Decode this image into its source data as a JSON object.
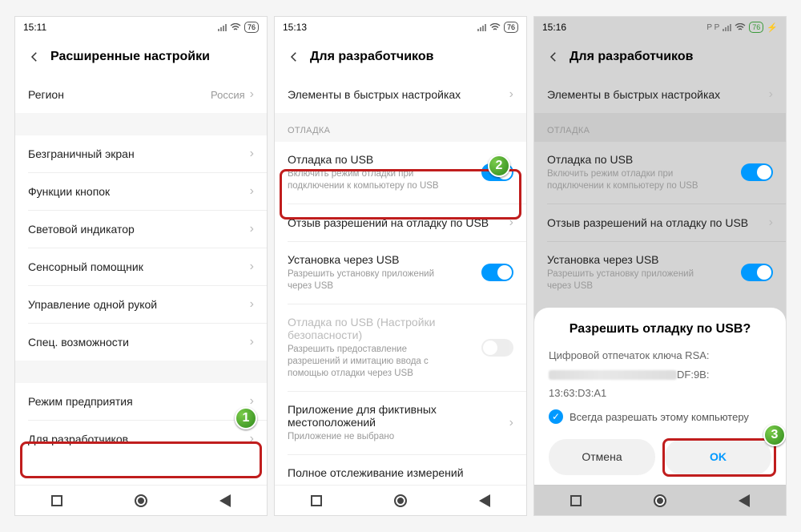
{
  "screen1": {
    "time": "15:11",
    "battery": "76",
    "title": "Расширенные настройки",
    "region_label": "Регион",
    "region_value": "Россия",
    "items": [
      "Безграничный экран",
      "Функции кнопок",
      "Световой индикатор",
      "Сенсорный помощник",
      "Управление одной рукой",
      "Спец. возможности"
    ],
    "enterprise": "Режим предприятия",
    "developers": "Для разработчиков"
  },
  "screen2": {
    "time": "15:13",
    "battery": "76",
    "title": "Для разработчиков",
    "quick_tiles": "Элементы в быстрых настройках",
    "section_debug": "ОТЛАДКА",
    "usb_debug_title": "Отладка по USB",
    "usb_debug_sub": "Включить режим отладки при подключении к компьютеру по USB",
    "revoke": "Отзыв разрешений на отладку по USB",
    "install_usb_title": "Установка через USB",
    "install_usb_sub": "Разрешить установку приложений через USB",
    "security_title": "Отладка по USB (Настройки безопасности)",
    "security_sub": "Разрешить предоставление разрешений и имитацию ввода с помощью отладки через USB",
    "mock_loc_title": "Приложение для фиктивных местоположений",
    "mock_loc_sub": "Приложение не выбрано",
    "measurements": "Полное отслеживание измерений"
  },
  "screen3": {
    "time": "15:16",
    "battery": "76",
    "title": "Для разработчиков",
    "quick_tiles": "Элементы в быстрых настройках",
    "section_debug": "ОТЛАДКА",
    "usb_debug_title": "Отладка по USB",
    "usb_debug_sub": "Включить режим отладки при подключении к компьютеру по USB",
    "revoke": "Отзыв разрешений на отладку по USB",
    "install_usb_title": "Установка через USB",
    "install_usb_sub": "Разрешить установку приложений через USB",
    "dialog_title": "Разрешить отладку по USB?",
    "rsa_label": "Цифровой отпечаток ключа RSA:",
    "rsa_tail": "DF:9B:",
    "rsa_line2": "13:63:D3:A1",
    "always_allow": "Всегда разрешать этому компьютеру",
    "cancel": "Отмена",
    "ok": "OK"
  },
  "badges": {
    "b1": "1",
    "b2": "2",
    "b3": "3"
  }
}
